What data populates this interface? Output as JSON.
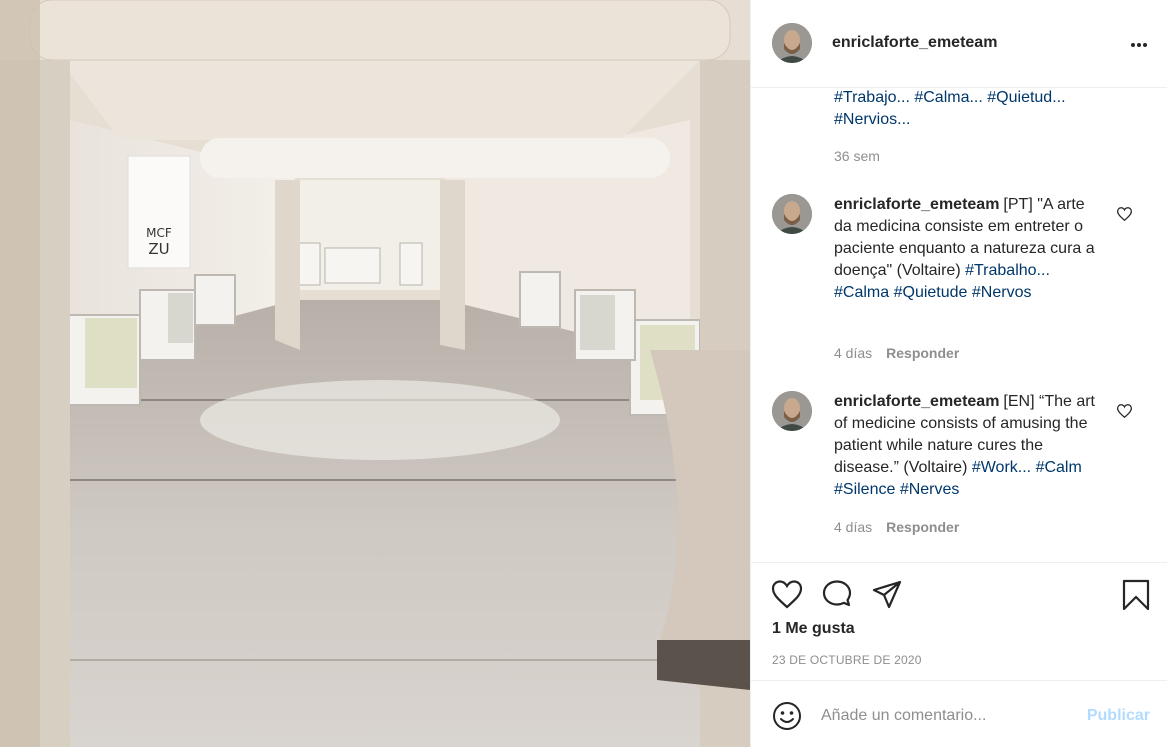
{
  "post": {
    "username": "enriclaforte_emeteam",
    "more_icon": "more-horizontal-icon",
    "photo_description_icon": "post-image",
    "eye_chart": {
      "row1": "MCF",
      "row2": "ZU"
    }
  },
  "caption_continuation": {
    "tags_line1": [
      "#Trabajo...",
      "#Calma...",
      "#Quietud..."
    ],
    "tags_line2": [
      "#Nervios..."
    ],
    "time": "36 sem"
  },
  "comments": [
    {
      "username": "enriclaforte_emeteam",
      "text_plain": "[PT] \"A arte da medicina consiste em entreter o paciente enquanto a natureza cura a doença\" (Voltaire)",
      "tags": [
        "#Trabalho...",
        "#Calma",
        "#Quietude",
        "#Nervos"
      ],
      "time": "4 días",
      "reply": "Responder"
    },
    {
      "username": "enriclaforte_emeteam",
      "text_plain": "[EN] “The art of medicine consists of amusing the patient while nature cures the disease.” (Voltaire)",
      "tags": [
        "#Work...",
        "#Calm",
        "#Silence",
        "#Nerves"
      ],
      "time": "4 días",
      "reply": "Responder"
    }
  ],
  "actions": {
    "like_icon": "heart-icon",
    "comment_icon": "comment-bubble-icon",
    "share_icon": "paper-plane-icon",
    "save_icon": "bookmark-icon",
    "likes_text": "1 Me gusta",
    "date_text": "23 DE OCTUBRE DE 2020"
  },
  "add_comment": {
    "emoji_icon": "emoji-icon",
    "placeholder": "Añade un comentario...",
    "post_label": "Publicar"
  },
  "colors": {
    "link_tag": "#00376b",
    "muted": "#8e8e8e",
    "publish_disabled": "#b3dbff",
    "divider": "#efefef"
  }
}
